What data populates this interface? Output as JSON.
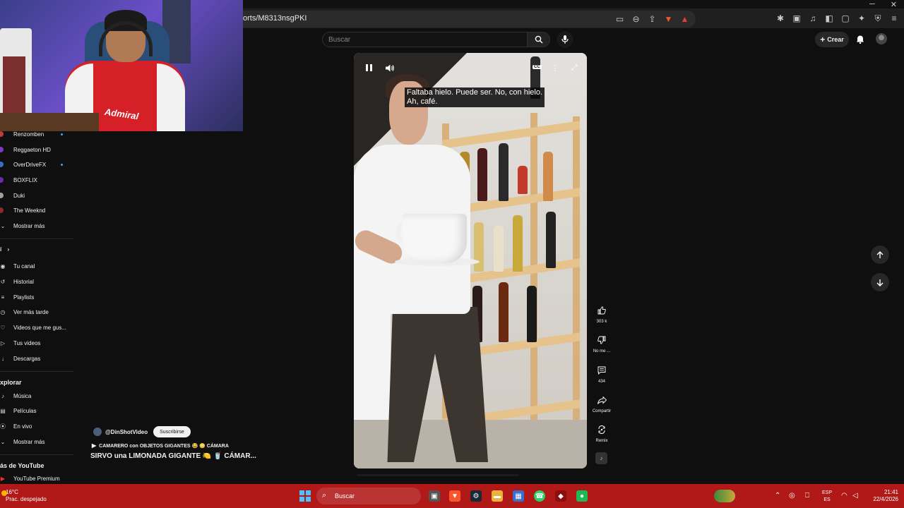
{
  "browser": {
    "url": "orts/M8313nsgPKI"
  },
  "header": {
    "search_placeholder": "Buscar",
    "create_label": "Crear"
  },
  "sidebar": {
    "subscriptions": [
      {
        "name": "Renzomben",
        "color": "#c23b3b",
        "live": true
      },
      {
        "name": "Reggaeton HD",
        "color": "#7a3bc2",
        "live": false
      },
      {
        "name": "OverDriveFX",
        "color": "#3b6ec2",
        "live": true
      },
      {
        "name": "BOXFLIX",
        "color": "#6a2bb0",
        "live": false
      },
      {
        "name": "Duki",
        "color": "#a0a0a0",
        "live": false
      },
      {
        "name": "The Weeknd",
        "color": "#8a2b2b",
        "live": false
      }
    ],
    "subs_show_more": "Mostrar más",
    "you_section": "í",
    "you_items": [
      {
        "label": "Tu canal",
        "icon": "channel-icon"
      },
      {
        "label": "Historial",
        "icon": "history-icon"
      },
      {
        "label": "Playlists",
        "icon": "playlists-icon"
      },
      {
        "label": "Ver más tarde",
        "icon": "watch-later-icon"
      },
      {
        "label": "Videos que me gus...",
        "icon": "liked-icon"
      },
      {
        "label": "Tus videos",
        "icon": "your-videos-icon"
      },
      {
        "label": "Descargas",
        "icon": "downloads-icon"
      }
    ],
    "explore_title": "xplorar",
    "explore_items": [
      {
        "label": "Música",
        "icon": "music-icon"
      },
      {
        "label": "Películas",
        "icon": "movies-icon"
      },
      {
        "label": "En vivo",
        "icon": "live-icon"
      },
      {
        "label": "Mostrar más",
        "icon": "chevron-down-icon"
      }
    ],
    "more_title": "ás de YouTube",
    "more_items": [
      {
        "label": "YouTube Premium",
        "icon": "youtube-premium-icon"
      }
    ]
  },
  "short": {
    "subtitle": "Faltaba hielo. Puede ser. No, con hielo.\nAh, café.",
    "channel": "@DinShotVideo",
    "subscribe_label": "Suscribirse",
    "playlist": "CAMARERO con OBJETOS GIGANTES 😂 😳 CÁMARA",
    "title": "SIRVO una LIMONADA GIGANTE 🍋 🥤 CÁMAR...",
    "actions": [
      {
        "name": "like-button",
        "icon": "thumbs-up-icon",
        "label": "303 k"
      },
      {
        "name": "dislike-button",
        "icon": "thumbs-down-icon",
        "label": "No me ..."
      },
      {
        "name": "comments-button",
        "icon": "comment-icon",
        "label": "434"
      },
      {
        "name": "share-button",
        "icon": "share-icon",
        "label": "Compartir"
      },
      {
        "name": "remix-button",
        "icon": "remix-icon",
        "label": "Remix"
      }
    ]
  },
  "taskbar": {
    "temperature": "16°C",
    "weather": "Prac. despejado",
    "search_label": "Buscar",
    "lang_top": "ESP",
    "lang_bottom": "ES",
    "time": "21:41",
    "date": "22/4/2026"
  },
  "colors": {
    "youtube_bg": "#0f0f0f",
    "taskbar": "#b11818",
    "accent_blue": "#3ea6ff"
  }
}
